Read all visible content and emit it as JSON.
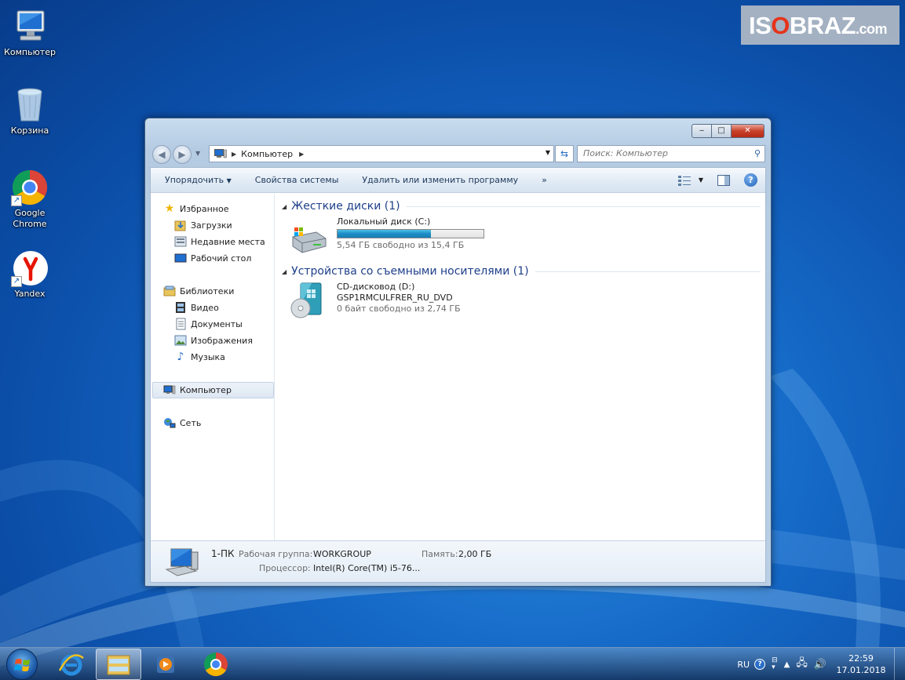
{
  "desktop": {
    "icons": [
      {
        "label": "Компьютер"
      },
      {
        "label": "Корзина"
      },
      {
        "label": "Google Chrome"
      },
      {
        "label": "Yandex"
      }
    ],
    "watermark": {
      "part1": "IS",
      "part2": "O",
      "part3": "BRAZ",
      "part4": ".com"
    }
  },
  "window": {
    "controls": {
      "minimize": "‒",
      "maximize": "□",
      "close": "✕"
    },
    "address": {
      "location": "Компьютер"
    },
    "search": {
      "placeholder": "Поиск: Компьютер"
    },
    "toolbar": {
      "organize": "Упорядочить",
      "system_properties": "Свойства системы",
      "uninstall": "Удалить или изменить программу",
      "more": "»"
    },
    "sidebar": {
      "favorites": "Избранное",
      "downloads": "Загрузки",
      "recent": "Недавние места",
      "desktop": "Рабочий стол",
      "libraries": "Библиотеки",
      "video": "Видео",
      "documents": "Документы",
      "pictures": "Изображения",
      "music": "Музыка",
      "computer": "Компьютер",
      "network": "Сеть"
    },
    "groups": {
      "hard_drives": "Жесткие диски (1)",
      "removable": "Устройства со съемными носителями (1)"
    },
    "drives": {
      "c": {
        "name": "Локальный диск (C:)",
        "free": "5,54 ГБ свободно из 15,4 ГБ",
        "used_fraction": 0.64
      },
      "d": {
        "name": "CD-дисковод (D:)",
        "label": "GSP1RMCULFRER_RU_DVD",
        "free": "0 байт свободно из 2,74 ГБ"
      }
    },
    "details": {
      "pc_name": "1-ПК",
      "workgroup_label": "Рабочая группа:",
      "workgroup": "WORKGROUP",
      "memory_label": "Память:",
      "memory": "2,00 ГБ",
      "cpu_label": "Процессор:",
      "cpu": "Intel(R) Core(TM) i5-76..."
    }
  },
  "taskbar": {
    "lang": "RU",
    "time": "22:59",
    "date": "17.01.2018"
  },
  "colors": {
    "accent": "#1e3f8a",
    "drive_bar": "#1d8cc5"
  }
}
